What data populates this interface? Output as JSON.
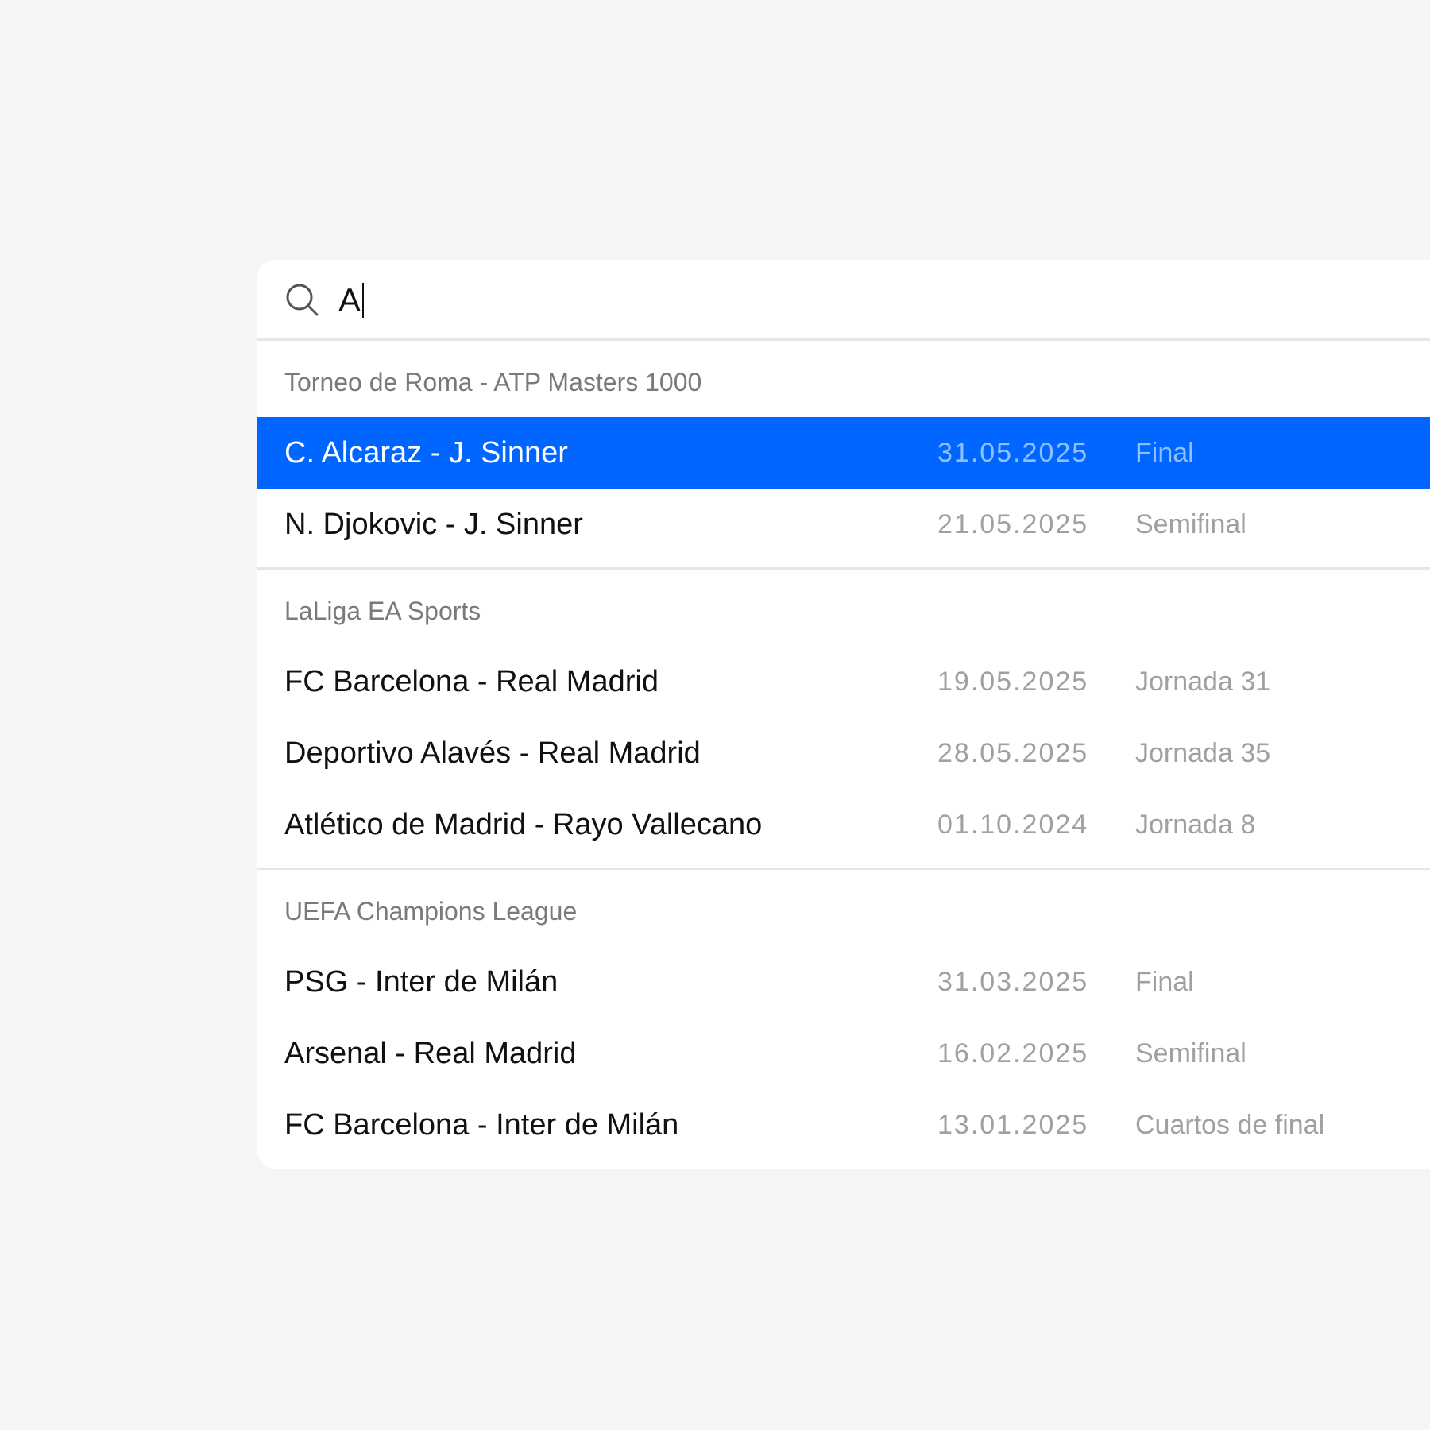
{
  "search": {
    "value": "A",
    "icon": "search-icon"
  },
  "colors": {
    "selected_bg": "#0066ff",
    "page_bg": "#f5f5f5",
    "panel_bg": "#ffffff"
  },
  "groups": [
    {
      "title": "Torneo de Roma - ATP Masters 1000",
      "rows": [
        {
          "match": "C. Alcaraz - J. Sinner",
          "date": "31.05.2025",
          "stage": "Final",
          "selected": true
        },
        {
          "match": "N. Djokovic - J. Sinner",
          "date": "21.05.2025",
          "stage": "Semifinal",
          "selected": false
        }
      ]
    },
    {
      "title": "LaLiga EA Sports",
      "rows": [
        {
          "match": "FC Barcelona - Real Madrid",
          "date": "19.05.2025",
          "stage": "Jornada 31",
          "selected": false
        },
        {
          "match": "Deportivo Alavés - Real Madrid",
          "date": "28.05.2025",
          "stage": "Jornada 35",
          "selected": false
        },
        {
          "match": "Atlético de Madrid - Rayo Vallecano",
          "date": "01.10.2024",
          "stage": "Jornada 8",
          "selected": false
        }
      ]
    },
    {
      "title": "UEFA Champions League",
      "rows": [
        {
          "match": "PSG - Inter de Milán",
          "date": "31.03.2025",
          "stage": "Final",
          "selected": false
        },
        {
          "match": "Arsenal - Real Madrid",
          "date": "16.02.2025",
          "stage": "Semifinal",
          "selected": false
        },
        {
          "match": "FC Barcelona - Inter de Milán",
          "date": "13.01.2025",
          "stage": "Cuartos de final",
          "selected": false
        }
      ]
    }
  ]
}
